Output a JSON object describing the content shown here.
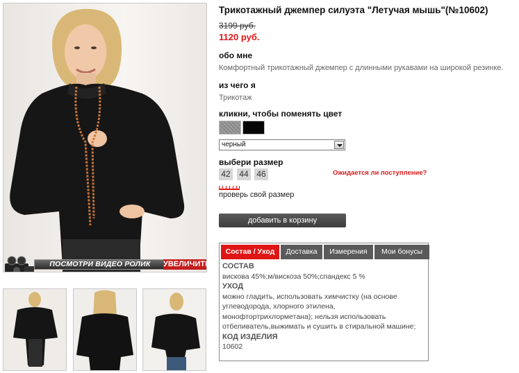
{
  "product": {
    "title": "Трикотажный джемпер силуэта \"Летучая мышь\"(№10602)",
    "old_price": "3199 руб.",
    "new_price": "1120 руб."
  },
  "about": {
    "heading": "обо мне",
    "text": "Комфортный трикотажный джемпер с длинными рукавами на широкой резинке."
  },
  "material": {
    "heading": "из чего я",
    "text": "Трикотаж"
  },
  "color": {
    "heading": "кликни, чтобы поменять цвет",
    "selected": "черный",
    "swatches": [
      "gray",
      "black"
    ]
  },
  "size": {
    "heading": "выбери размер",
    "options": [
      "42",
      "44",
      "46"
    ],
    "expect_link": "Ожидается ли поступление?",
    "check_link": "проверь свой размер"
  },
  "cart_button": "добавить в корзину",
  "video_label": "ПОСМОТРИ ВИДЕО РОЛИК",
  "zoom_label": "УВЕЛИЧИТЬ",
  "tabs": [
    "Состав / Уход",
    "Доставка",
    "Измерения",
    "Мои бонусы"
  ],
  "tab_content": {
    "composition_heading": "СОСТАВ",
    "composition": "вискова 45%;м/вискоза 50%;спандекс 5 %",
    "care_heading": "УХОД",
    "care": "можно гладить, использовать химчистку (на основе углеводорода, хлорного этилена, монофтортрихлорметана); нельзя использовать отбеливатель,выжимать и сушить в стиральной машине;",
    "code_heading": "КОД ИЗДЕЛИЯ",
    "code": "10602"
  },
  "colors": {
    "accent": "#e01515",
    "tab_inactive": "#5a5a5a",
    "button": "#4a4a4a"
  }
}
